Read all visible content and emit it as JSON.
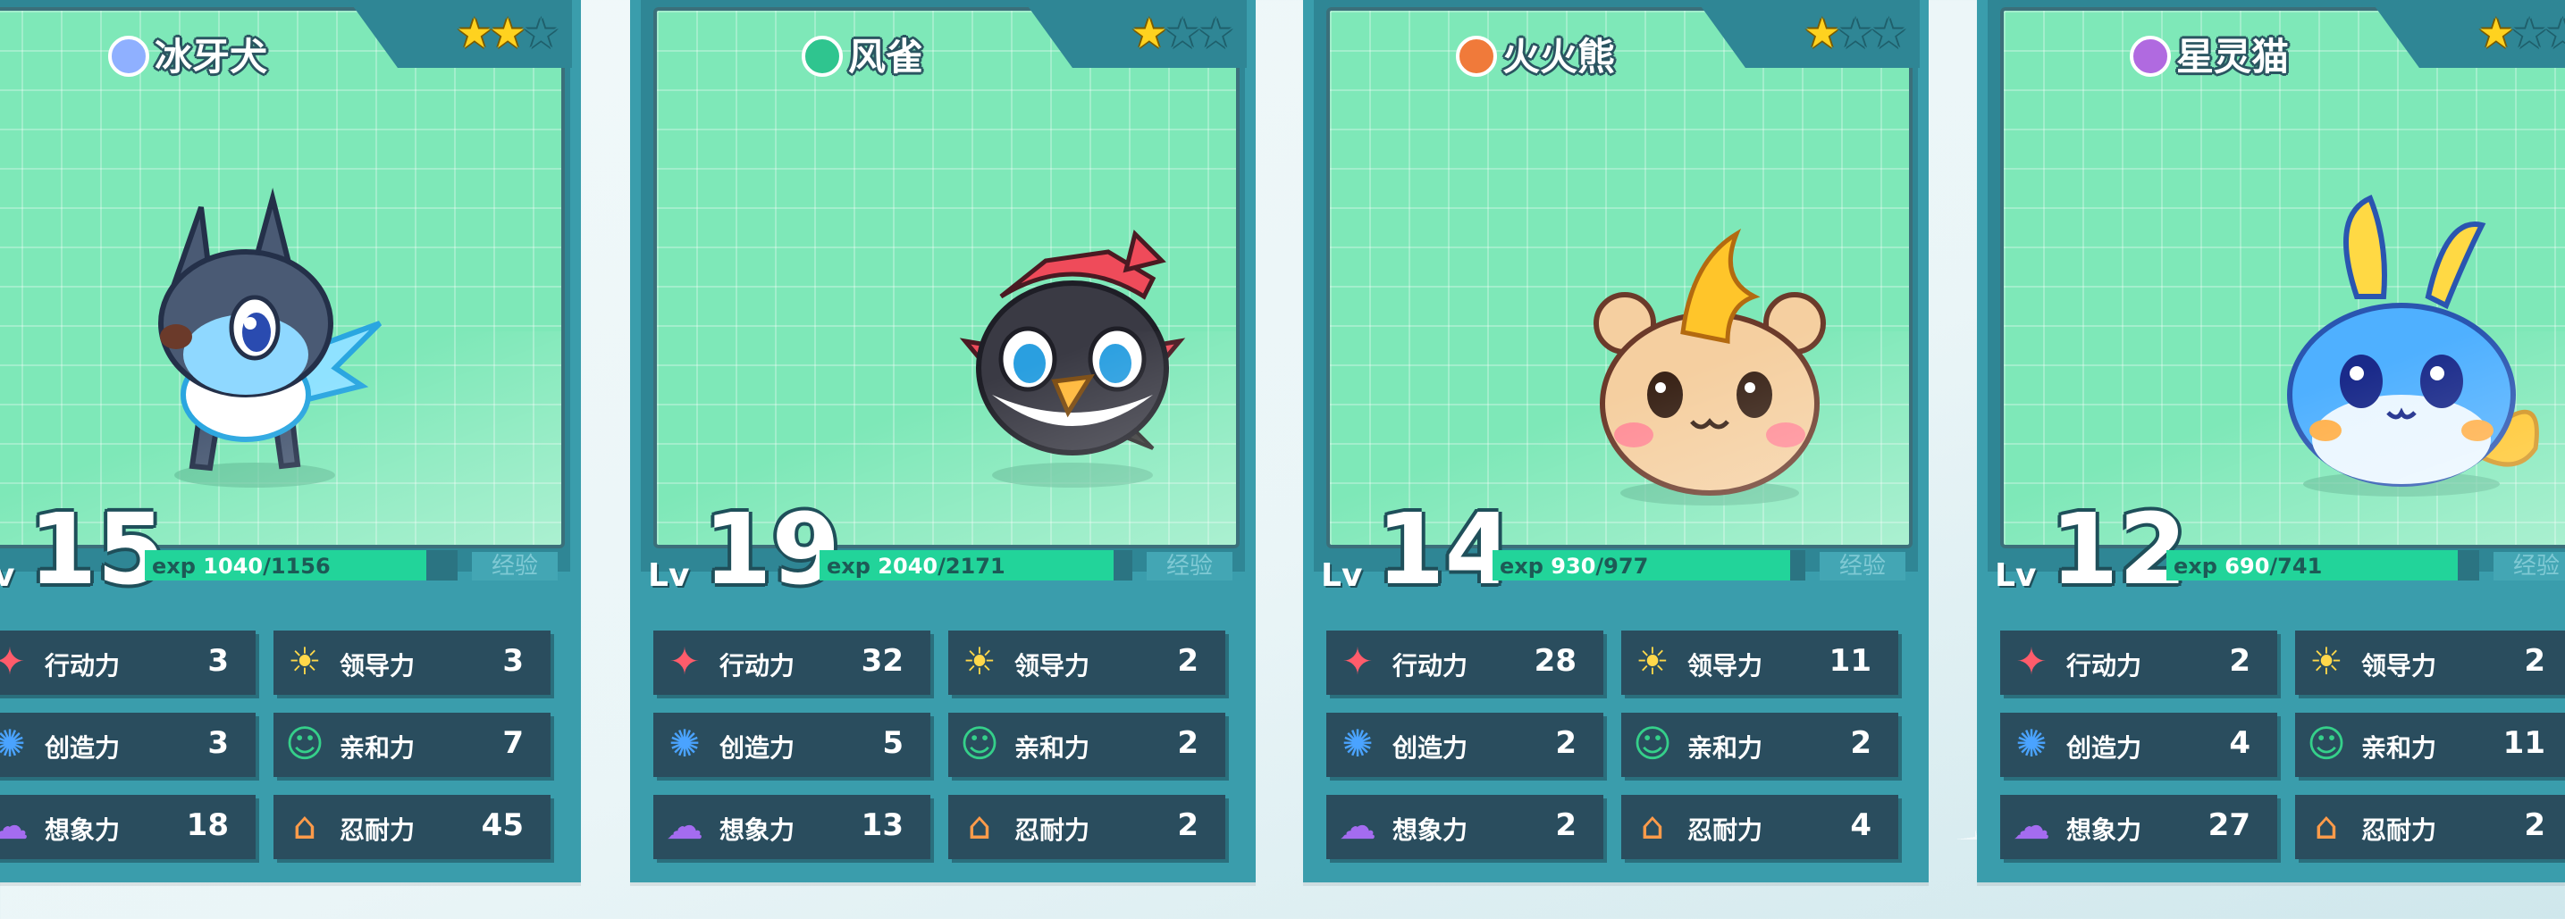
{
  "stat_labels": {
    "action": "行动力",
    "leadership": "领导力",
    "creativity": "创造力",
    "affinity": "亲和力",
    "imagination": "想象力",
    "endurance": "忍耐力"
  },
  "exp_button_label": "经验",
  "lv_label": "Lv",
  "exp_prefix": "exp",
  "colors": {
    "card": "#3a9dac",
    "art_bg": "#7ee8b8",
    "exp_fill": "#22d49a",
    "stat_bg": "#2a4d5e",
    "star": "#ffd21f"
  },
  "cards": [
    {
      "name": "冰牙犬",
      "element_icon": "snowflake-icon",
      "element_color": "#8fb0ff",
      "stars": 2,
      "level": "15",
      "exp_current": "1040",
      "exp_sep": "/",
      "exp_max": "1156",
      "exp_fraction": 0.9,
      "stats": {
        "action": "3",
        "leadership": "3",
        "creativity": "3",
        "affinity": "7",
        "imagination": "18",
        "endurance": "45"
      }
    },
    {
      "name": "风雀",
      "element_icon": "wind-icon",
      "element_color": "#2fc58f",
      "stars": 1,
      "level": "19",
      "exp_current": "2040",
      "exp_sep": "/",
      "exp_max": "2171",
      "exp_fraction": 0.94,
      "stats": {
        "action": "32",
        "leadership": "2",
        "creativity": "5",
        "affinity": "2",
        "imagination": "13",
        "endurance": "2"
      }
    },
    {
      "name": "火火熊",
      "element_icon": "flame-icon",
      "element_color": "#f07a3a",
      "stars": 1,
      "level": "14",
      "exp_current": "930",
      "exp_sep": "/",
      "exp_max": "977",
      "exp_fraction": 0.95,
      "stats": {
        "action": "28",
        "leadership": "11",
        "creativity": "2",
        "affinity": "2",
        "imagination": "2",
        "endurance": "4"
      }
    },
    {
      "name": "星灵猫",
      "element_icon": "spirit-icon",
      "element_color": "#b06ae0",
      "stars": 1,
      "level": "12",
      "exp_current": "690",
      "exp_sep": "/",
      "exp_max": "741",
      "exp_fraction": 0.93,
      "stats": {
        "action": "2",
        "leadership": "2",
        "creativity": "4",
        "affinity": "11",
        "imagination": "27",
        "endurance": "2"
      }
    }
  ]
}
